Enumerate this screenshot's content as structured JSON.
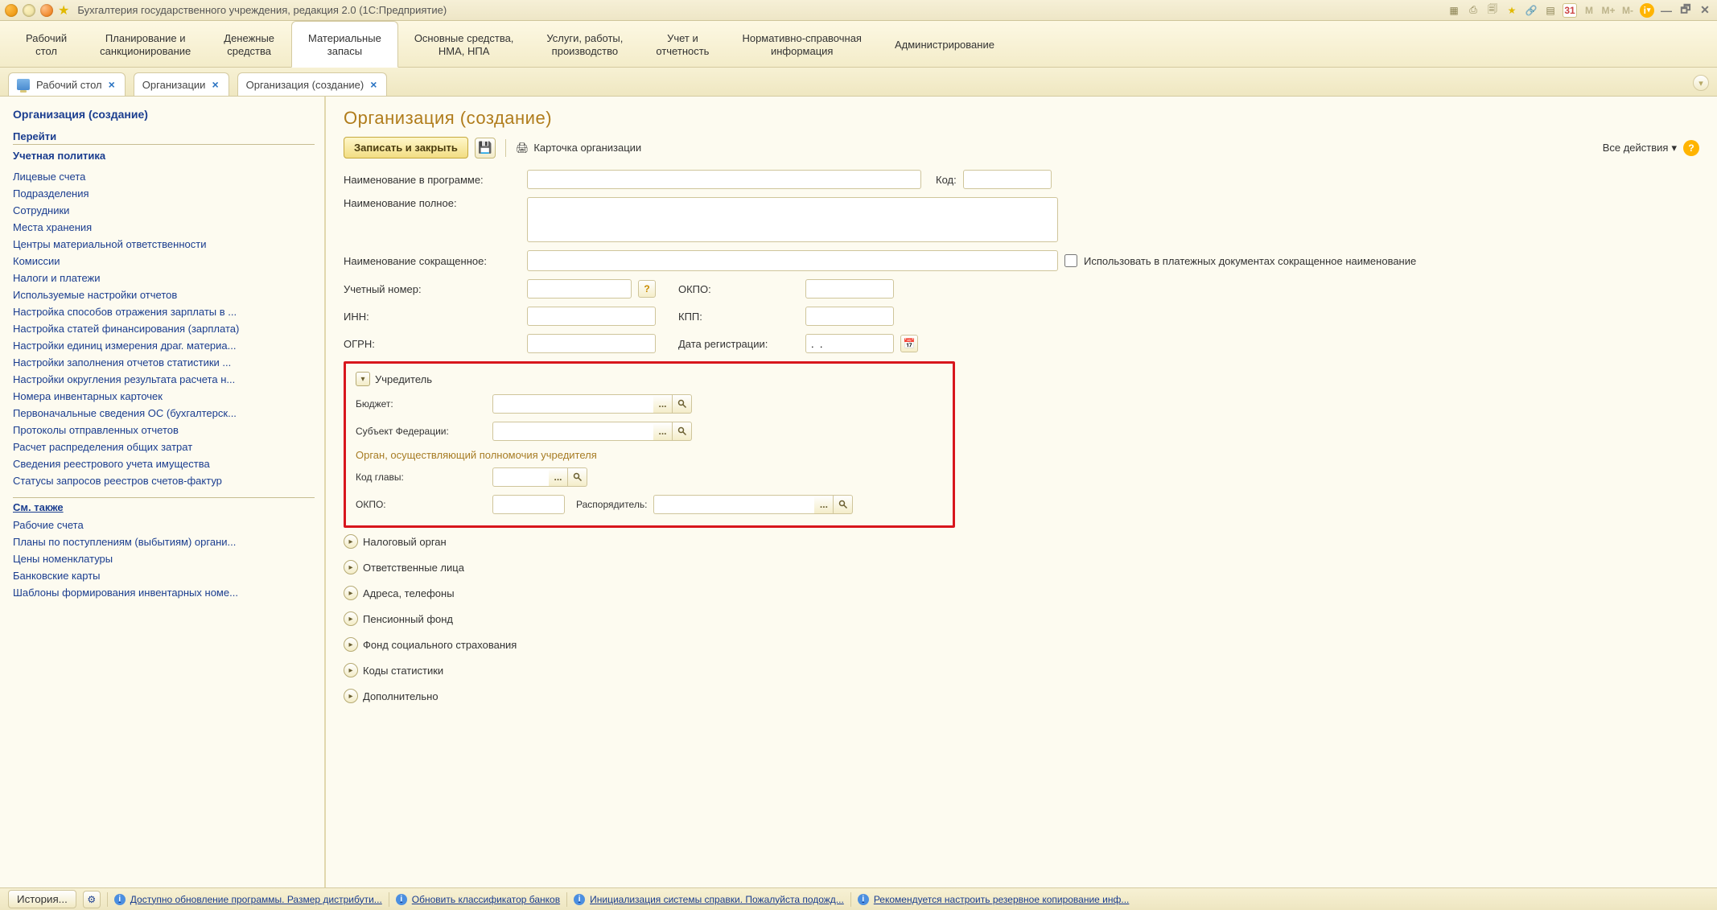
{
  "window": {
    "title": "Бухгалтерия государственного учреждения, редакция 2.0  (1С:Предприятие)"
  },
  "toolbar_right": {
    "m": "M",
    "mplus": "M+",
    "mminus": "M-",
    "cal": "31",
    "info": "i"
  },
  "sections": [
    "Рабочий\nстол",
    "Планирование и\nсанкционирование",
    "Денежные\nсредства",
    "Материальные\nзапасы",
    "Основные средства,\nНМА, НПА",
    "Услуги, работы,\nпроизводство",
    "Учет и\nотчетность",
    "Нормативно-справочная\nинформация",
    "Администрирование"
  ],
  "active_section_index": 3,
  "tabs": {
    "desktop": "Рабочий стол",
    "org_list": "Организации",
    "org_create": "Организация (создание)"
  },
  "left": {
    "title": "Организация (создание)",
    "group_go": "Перейти",
    "group_policy": "Учетная политика",
    "links": [
      "Лицевые счета",
      "Подразделения",
      "Сотрудники",
      "Места хранения",
      "Центры материальной ответственности",
      "Комиссии",
      "Налоги и платежи",
      "Используемые настройки отчетов",
      "Настройка способов отражения зарплаты в ...",
      "Настройка статей финансирования (зарплата)",
      "Настройки единиц измерения драг. материа...",
      "Настройки заполнения отчетов статистики ...",
      "Настройки округления результата расчета н...",
      "Номера инвентарных карточек",
      "Первоначальные сведения ОС (бухгалтерск...",
      "Протоколы отправленных отчетов",
      "Расчет распределения общих затрат",
      "Сведения реестрового учета имущества",
      "Статусы запросов реестров счетов-фактур"
    ],
    "group_seealso": "См. также",
    "seealso": [
      "Рабочие счета",
      "Планы по поступлениям (выбытиям) органи...",
      "Цены номенклатуры",
      "Банковские карты",
      "Шаблоны формирования инвентарных номе..."
    ]
  },
  "form": {
    "title": "Организация (создание)",
    "btn_save": "Записать и закрыть",
    "btn_card": "Карточка организации",
    "all_actions": "Все действия",
    "labels": {
      "program_name": "Наименование в программе:",
      "kod": "Код:",
      "full_name": "Наименование полное:",
      "short_name": "Наименование сокращенное:",
      "use_short": "Использовать в платежных документах сокращенное наименование",
      "uch_no": "Учетный номер:",
      "okpo": "ОКПО:",
      "inn": "ИНН:",
      "kpp": "КПП:",
      "ogrn": "ОГРН:",
      "reg_date": "Дата регистрации:",
      "reg_date_value": ".  .",
      "founder": "Учредитель",
      "budget": "Бюджет:",
      "subject": "Субъект Федерации:",
      "organ": "Орган, осуществляющий полномочия учредителя",
      "chapter": "Код главы:",
      "okpo2": "ОКПО:",
      "manager": "Распорядитель:"
    },
    "collapsed": [
      "Налоговый орган",
      "Ответственные лица",
      "Адреса, телефоны",
      "Пенсионный фонд",
      "Фонд социального страхования",
      "Коды статистики",
      "Дополнительно"
    ]
  },
  "statusbar": {
    "history": "История...",
    "msg_update": "Доступно обновление программы. Размер дистрибути...",
    "msg_banks": "Обновить классификатор банков",
    "msg_help": "Инициализация системы справки. Пожалуйста подожд...",
    "msg_backup": "Рекомендуется настроить резервное копирование инф..."
  }
}
